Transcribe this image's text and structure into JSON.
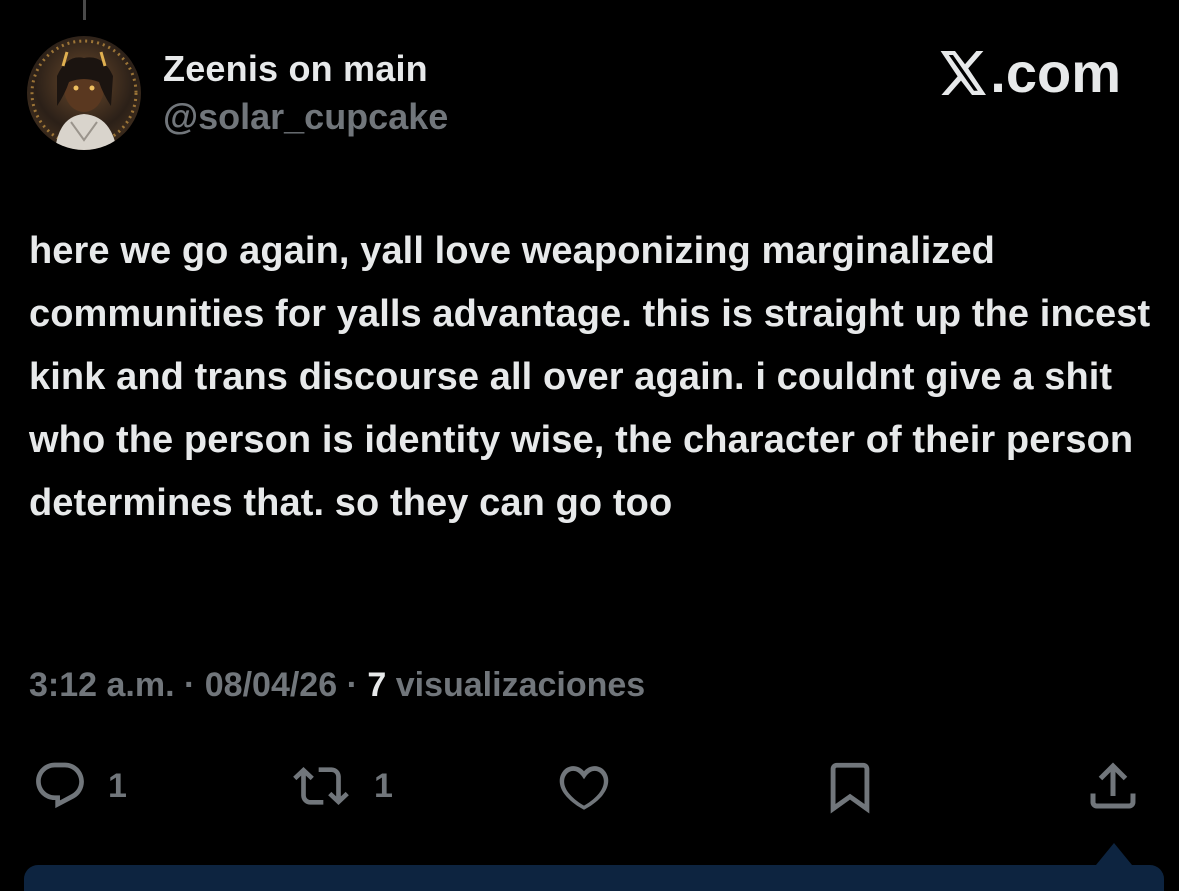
{
  "tweet": {
    "display_name": "Zeenis on main",
    "handle": "@solar_cupcake",
    "brand": ".com",
    "text": "here we go again, yall love weaponizing marginalized communities for yalls advantage. this is straight up the incest kink and trans discourse all over again. i couldnt give a shit who the person is identity wise, the character of their person determines that. so they can go too",
    "time": "3:12 a.m.",
    "date": "08/04/26",
    "views_count": "7",
    "views_label": "visualizaciones"
  },
  "actions": {
    "reply_count": "1",
    "retweet_count": "1"
  },
  "icons": {
    "avatar": "avatar-image",
    "brand": "x-logo-icon",
    "reply": "reply-icon",
    "retweet": "retweet-icon",
    "like": "heart-icon",
    "bookmark": "bookmark-icon",
    "share": "share-icon"
  },
  "colors": {
    "background": "#000000",
    "text_primary": "#e7e9ea",
    "text_secondary": "#71767b",
    "bottom_bar": "#0d2440"
  }
}
